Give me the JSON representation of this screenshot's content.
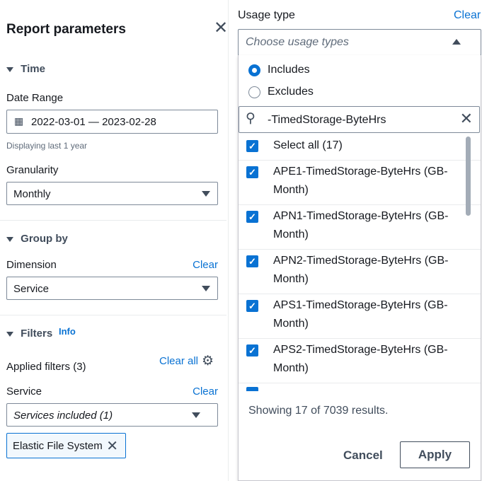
{
  "panel": {
    "title": "Report parameters",
    "time": {
      "heading": "Time",
      "date_label": "Date Range",
      "date_value": "2022-03-01 — 2023-02-28",
      "date_help": "Displaying last 1 year",
      "gran_label": "Granularity",
      "gran_value": "Monthly"
    },
    "group_by": {
      "heading": "Group by",
      "dim_label": "Dimension",
      "clear": "Clear",
      "dim_value": "Service"
    },
    "filters": {
      "heading": "Filters",
      "info": "Info",
      "applied": "Applied filters (3)",
      "clear_all": "Clear all",
      "service_label": "Service",
      "service_clear": "Clear",
      "service_placeholder": "Services included (1)",
      "token": "Elastic File System"
    }
  },
  "usage": {
    "label": "Usage type",
    "clear": "Clear",
    "placeholder": "Choose usage types",
    "includes": "Includes",
    "excludes": "Excludes",
    "search_value": "-TimedStorage-ByteHrs",
    "select_all": "Select all (17)",
    "items": [
      "APE1-TimedStorage-ByteHrs (GB-Month)",
      "APN1-TimedStorage-ByteHrs (GB-Month)",
      "APN2-TimedStorage-ByteHrs (GB-Month)",
      "APS1-TimedStorage-ByteHrs (GB-Month)",
      "APS2-TimedStorage-ByteHrs (GB-Month)"
    ],
    "status": "Showing 17 of 7039 results.",
    "cancel": "Cancel",
    "apply": "Apply"
  }
}
